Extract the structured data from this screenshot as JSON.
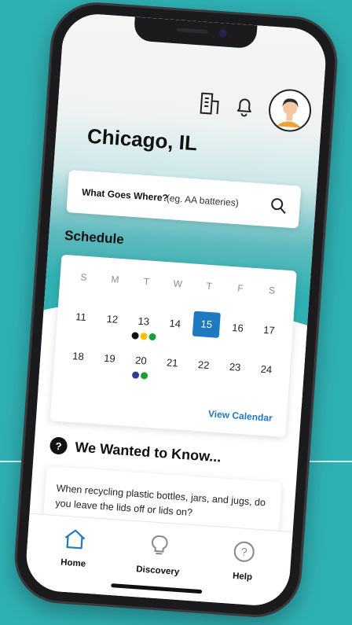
{
  "header": {
    "city": "Chicago, IL",
    "icons": [
      "building-icon",
      "bell-icon"
    ]
  },
  "search": {
    "label": "What Goes Where?",
    "placeholder": "(eg. AA batteries)"
  },
  "schedule": {
    "title": "Schedule",
    "weekdays": [
      "S",
      "M",
      "T",
      "W",
      "T",
      "F",
      "S"
    ],
    "weeks": [
      [
        "11",
        "12",
        "13",
        "14",
        "15",
        "16",
        "17"
      ],
      [
        "18",
        "19",
        "20",
        "21",
        "22",
        "23",
        "24"
      ]
    ],
    "today": "15",
    "view_calendar": "View Calendar",
    "pickup_dots": {
      "13": [
        "#111111",
        "#f2c200",
        "#1f9d3a"
      ],
      "20": [
        "#2f3d8f",
        "#1f9d3a"
      ]
    }
  },
  "know": {
    "title": "We Wanted to Know...",
    "question": "When recycling plastic bottles, jars, and jugs, do you leave the lids off or lids on?"
  },
  "tabs": [
    {
      "label": "Home",
      "icon": "home-icon"
    },
    {
      "label": "Discovery",
      "icon": "lightbulb-icon"
    },
    {
      "label": "Help",
      "icon": "help-icon"
    }
  ],
  "colors": {
    "background": "#2fb0b3",
    "accent": "#1f79c0"
  }
}
